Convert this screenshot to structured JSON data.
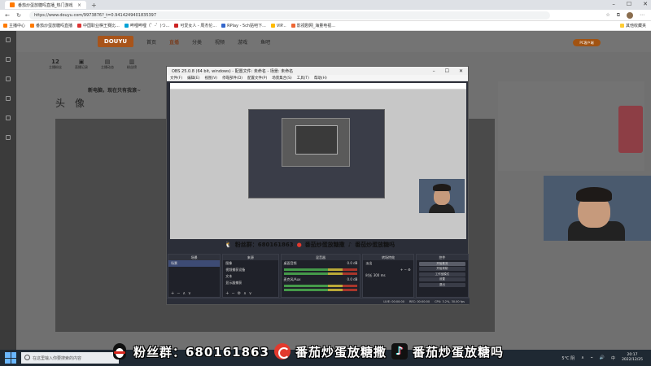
{
  "browser": {
    "tab_title": "番茄炒蛋放糖吗直播_热门游戏",
    "url": "https://www.douyu.com/9973876?_t=0.9414249401835397",
    "bookmarks": [
      "主播中心",
      "番茄炒蛋放糖吗直播",
      "中国职业棋王赛比...",
      "哔哩哔哩（゜-゜)つ...",
      "可爱女人 - 周杰伦...",
      "RPlay - 5ch贴吧下...",
      "VIP...",
      "影视剧网_海量电视..."
    ],
    "bookmarks_right": "其他收藏夹"
  },
  "site": {
    "nav": [
      "首页",
      "直播",
      "分类",
      "视频",
      "游戏",
      "鱼吧"
    ],
    "active_nav": 1,
    "top_button": "PC客户端",
    "stats": [
      {
        "value": "12",
        "label": "主播粉丝"
      },
      {
        "value": "",
        "label": "直播记录"
      },
      {
        "value": "",
        "label": "主播动态"
      },
      {
        "value": "",
        "label": "粉丝榜"
      }
    ],
    "stream_title": "新电脑，现在只有我滚~",
    "head_text": "头 像"
  },
  "obs": {
    "title": "OBS 25.0.8 (64 bit, windows) - 配置文件: 未命名 - 场景: 未命名",
    "menu": [
      "文件(F)",
      "编辑(E)",
      "视图(V)",
      "停靠部件(D)",
      "配置文件(P)",
      "场景集合(S)",
      "工具(T)",
      "帮助(H)"
    ],
    "docks": {
      "scenes": {
        "title": "场景",
        "items": [
          "场景"
        ]
      },
      "sources": {
        "title": "来源",
        "items": [
          "图像",
          "视频捕获设备",
          "文本",
          "显示器捕获"
        ]
      },
      "mixer": {
        "title": "混音器",
        "items": [
          {
            "name": "桌面音频",
            "db": "0.0 dB"
          },
          {
            "name": "麦克风/Aux",
            "db": "0.0 dB"
          }
        ]
      },
      "transitions": {
        "title": "转场特效",
        "mode": "淡出",
        "duration_label": "时长",
        "duration": "300 ms"
      },
      "controls": {
        "title": "控件",
        "buttons": [
          "开始推流",
          "开始录制",
          "工作室模式",
          "设置",
          "退出"
        ]
      }
    },
    "status": [
      "LIVE: 00:00:00",
      "REC: 00:00:00",
      "CPU: 3.2%, 30.00 fps"
    ],
    "overlay_text": [
      "粉丝群：680161863",
      "番茄炒蛋放糖撒",
      "番茄炒蛋放糖吗"
    ]
  },
  "watermark": {
    "qq_group": "粉丝群：680161863",
    "xigua": "番茄炒蛋放糖撒",
    "douyin": "番茄炒蛋放糖吗"
  },
  "taskbar": {
    "search_placeholder": "在这里输入你要搜索的内容",
    "weather": "5°C 阴",
    "lang": "中",
    "time": "20:17",
    "date": "2022/12/25"
  }
}
